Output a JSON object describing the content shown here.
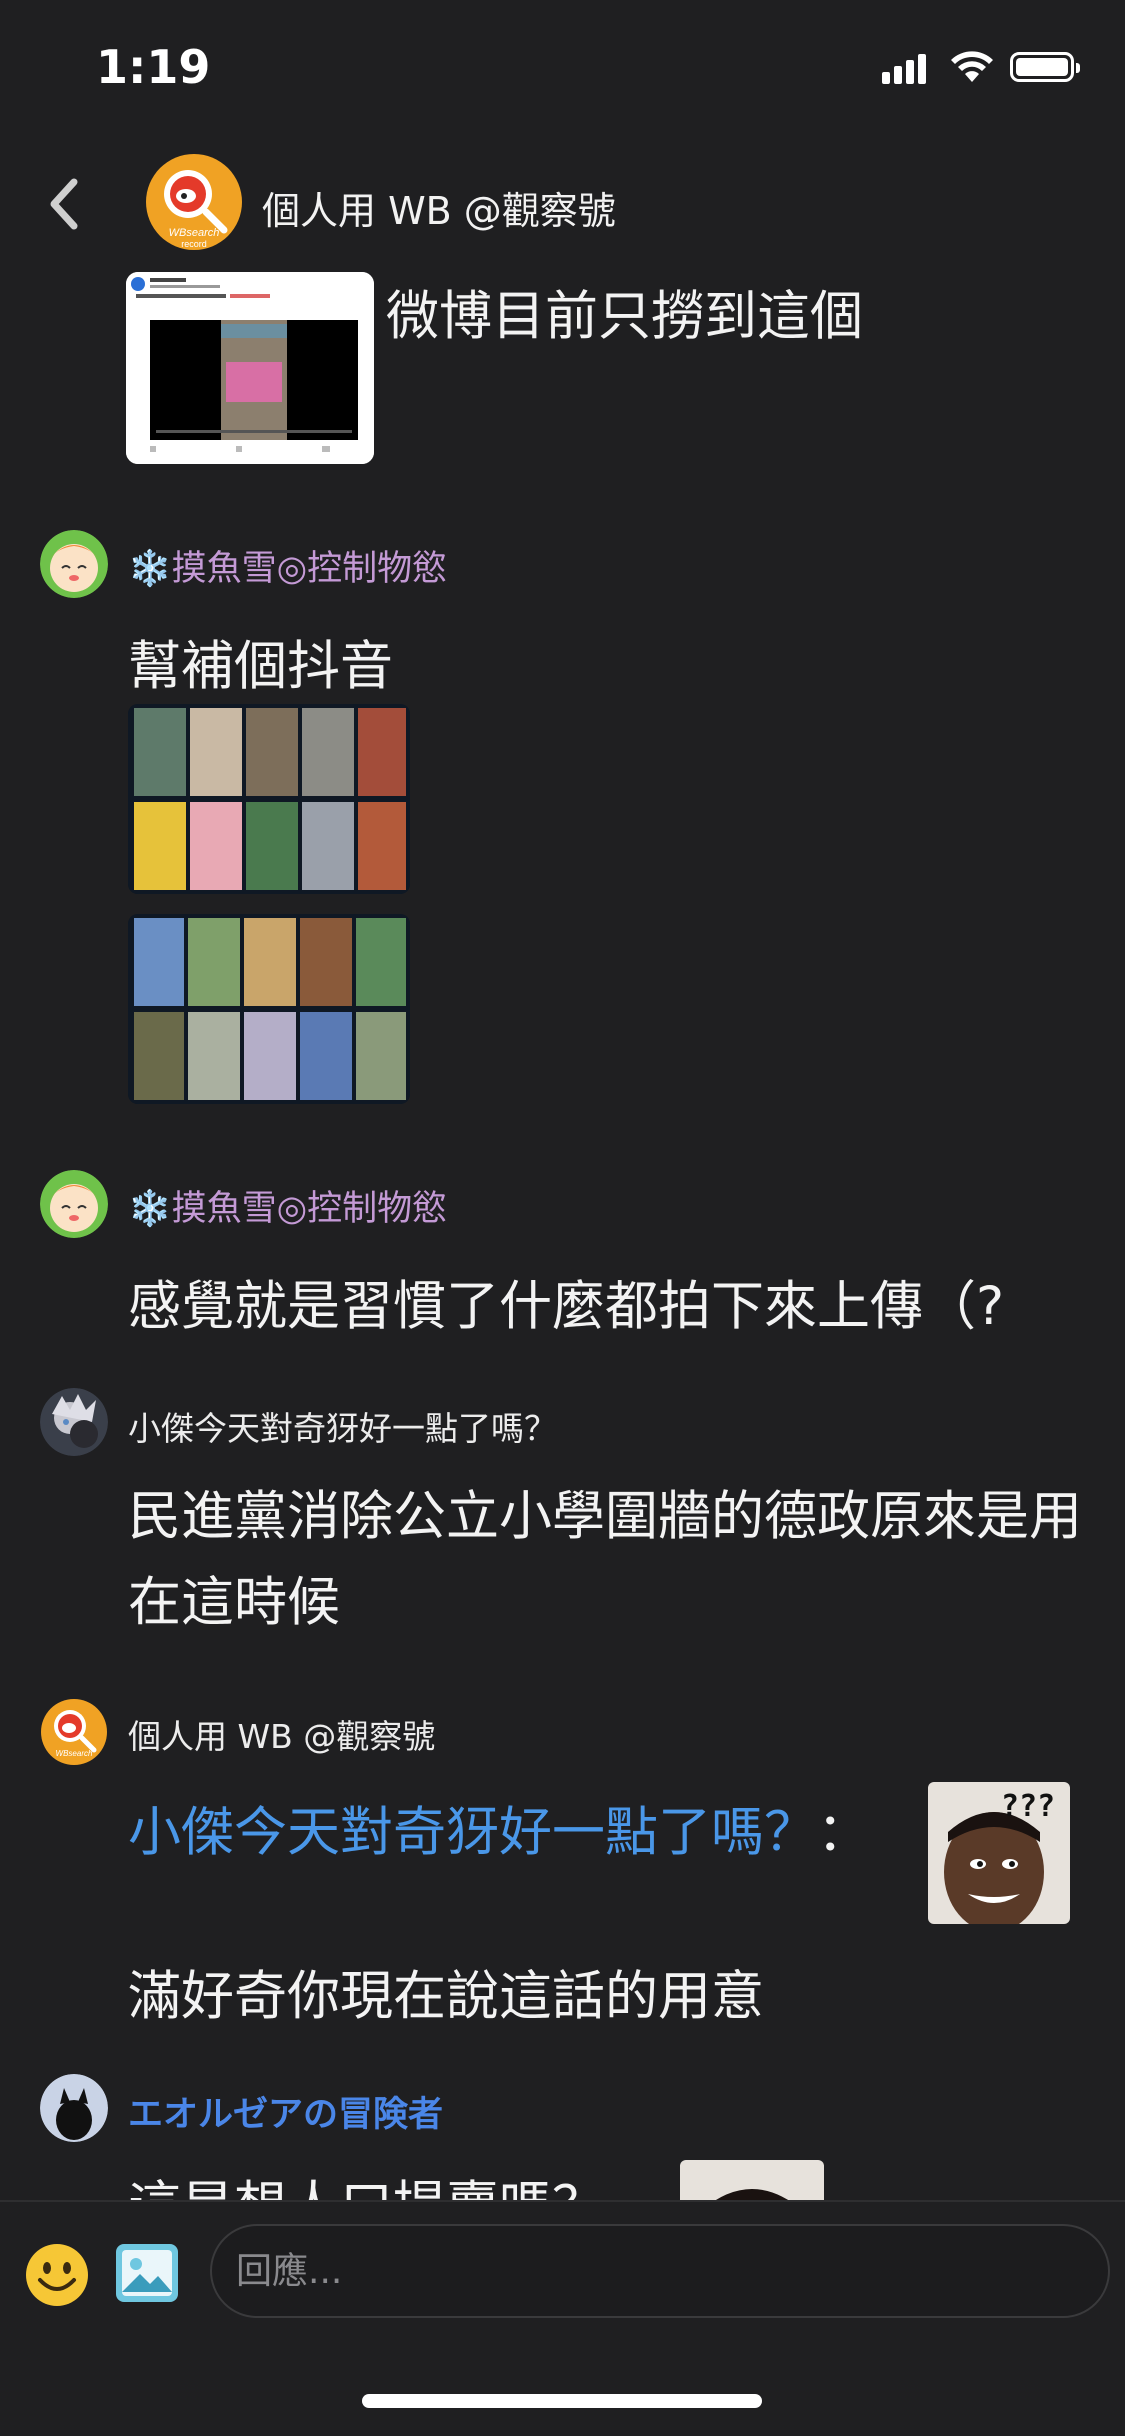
{
  "status_bar": {
    "time": "1:19"
  },
  "header": {
    "title": "個人用 WB @觀察號",
    "avatar_icon": "wbsearch-logo",
    "avatar_label": "WBsearch record"
  },
  "messages": [
    {
      "id": "m1",
      "author": "個人用 WB @觀察號",
      "text": "微博目前只撈到這個",
      "attachment": "weibo-video-screenshot"
    },
    {
      "id": "m2",
      "author": "❄️摸魚雪◎控制物慾",
      "author_color": "#c49ad6",
      "text": "幫補個抖音",
      "attachments": [
        "douyin-grid-screenshot-1",
        "douyin-grid-screenshot-2"
      ]
    },
    {
      "id": "m3",
      "author": "❄️摸魚雪◎控制物慾",
      "author_color": "#c49ad6",
      "text": "感覺就是習慣了什麼都拍下來上傳（?"
    },
    {
      "id": "m4",
      "author": "小傑今天對奇犽好一點了嗎？",
      "text": "民進黨消除公立小學圍牆的德政原來是用在這時候"
    },
    {
      "id": "m5",
      "author": "個人用 WB @觀察號",
      "mention": "小傑今天對奇犽好一點了嗎？",
      "mention_separator": "：",
      "sticker": "confused-meme",
      "sticker_text": "???",
      "text": "滿好奇你現在說這話的用意"
    },
    {
      "id": "m6",
      "author": "エオルゼアの冒険者",
      "author_color": "#4a86e8",
      "text": "這是想人口提賣嗎？"
    }
  ],
  "input_bar": {
    "placeholder": "回應...",
    "emoji_icon": "smiley-icon",
    "image_icon": "image-icon"
  }
}
